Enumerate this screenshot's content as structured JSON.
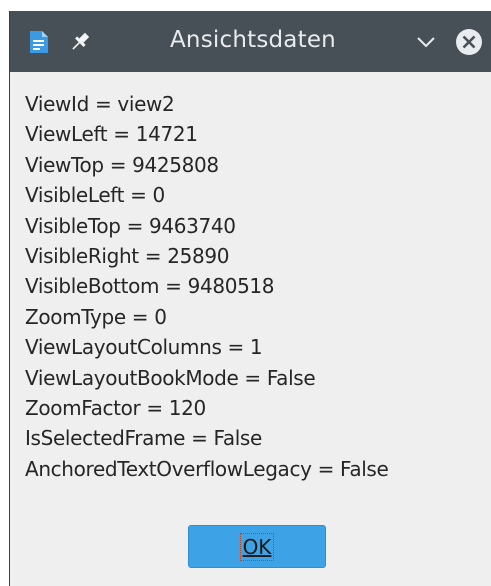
{
  "window": {
    "title": "Ansichtsdaten",
    "icons": {
      "app": "document-app-icon",
      "pin": "pin-icon",
      "menu": "chevron-down-icon",
      "close": "close-icon"
    }
  },
  "view_data": {
    "lines": [
      "ViewId = view2",
      "ViewLeft = 14721",
      "ViewTop = 9425808",
      "VisibleLeft = 0",
      "VisibleTop = 9463740",
      "VisibleRight = 25890",
      "VisibleBottom = 9480518",
      "ZoomType = 0",
      "ViewLayoutColumns = 1",
      "ViewLayoutBookMode = False",
      "ZoomFactor = 120",
      "IsSelectedFrame = False",
      "AnchoredTextOverflowLegacy = False"
    ]
  },
  "buttons": {
    "ok_label": "OK"
  },
  "colors": {
    "titlebar": "#475057",
    "dialog_background": "#efefef",
    "button_accent": "#3da3e6"
  }
}
